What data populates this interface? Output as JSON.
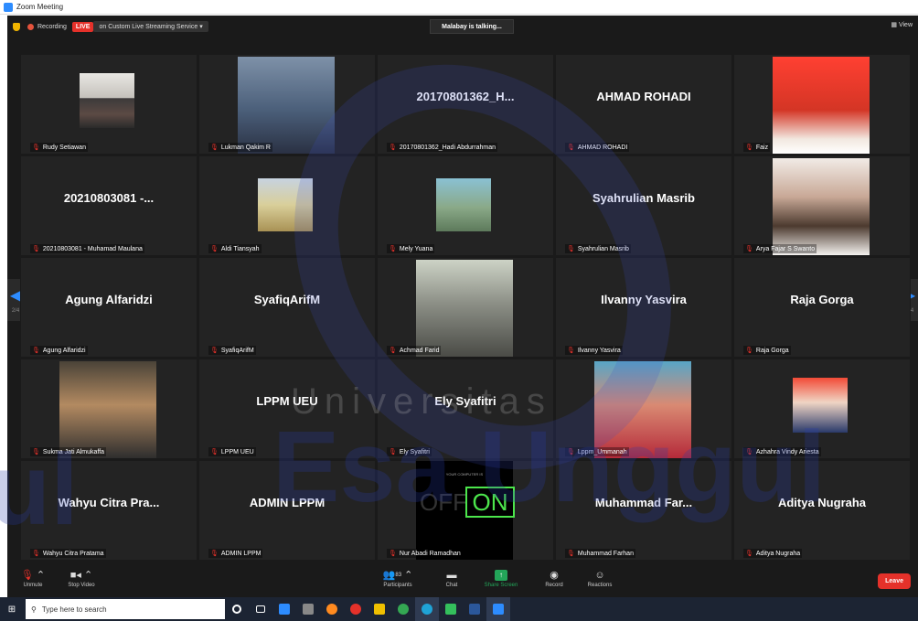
{
  "window": {
    "title": "Zoom Meeting"
  },
  "topbar": {
    "recording": "Recording",
    "live": "LIVE",
    "stream": "on Custom Live Streaming Service",
    "talking": "Malabay is talking...",
    "view": "View"
  },
  "pager": {
    "page": "2/4"
  },
  "tiles": [
    {
      "name": "Rudy Setiawan",
      "big": "",
      "photo": "hat"
    },
    {
      "name": "Lukman Qakim R",
      "big": "",
      "photo": "selfie"
    },
    {
      "name": "20170801362_Hadi Abdurrahman",
      "big": "20170801362_H...",
      "photo": ""
    },
    {
      "name": "AHMAD ROHADI",
      "big": "AHMAD ROHADI",
      "photo": ""
    },
    {
      "name": "Faiz",
      "big": "",
      "photo": "portrait-red"
    },
    {
      "name": "20210803081 - Muhamad Maulana",
      "big": "20210803081 -...",
      "photo": ""
    },
    {
      "name": "Aldi Tiansyah",
      "big": "",
      "photo": "field"
    },
    {
      "name": "Mely Yuana",
      "big": "",
      "photo": "park"
    },
    {
      "name": "Syahrulian Masrib",
      "big": "Syahrulian Masrib",
      "photo": ""
    },
    {
      "name": "Arya Fajar S Swanto",
      "big": "",
      "photo": "girl"
    },
    {
      "name": "Agung Alfaridzi",
      "big": "Agung Alfaridzi",
      "photo": ""
    },
    {
      "name": "SyafiqArifM",
      "big": "SyafiqArifM",
      "photo": ""
    },
    {
      "name": "Achmad Farid",
      "big": "",
      "photo": "street"
    },
    {
      "name": "Ilvanny Yasvira",
      "big": "Ilvanny Yasvira",
      "photo": ""
    },
    {
      "name": "Raja Gorga",
      "big": "Raja Gorga",
      "photo": ""
    },
    {
      "name": "Sukma Jati Almukaffa",
      "big": "",
      "photo": "mask"
    },
    {
      "name": "LPPM UEU",
      "big": "LPPM UEU",
      "photo": ""
    },
    {
      "name": "Ely Syafitri",
      "big": "Ely Syafitri",
      "photo": ""
    },
    {
      "name": "Lppm_Ummanah",
      "big": "",
      "photo": "hijab"
    },
    {
      "name": "Azhahra Vindy Ariesta",
      "big": "",
      "photo": "hijabred"
    },
    {
      "name": "Wahyu Citra Pratama",
      "big": "Wahyu Citra Pra...",
      "photo": ""
    },
    {
      "name": "ADMIN LPPM",
      "big": "ADMIN LPPM",
      "photo": ""
    },
    {
      "name": "Nur Abadi Ramadhan",
      "big": "",
      "photo": "onoff"
    },
    {
      "name": "Muhammad Farhan",
      "big": "Muhammad Far...",
      "photo": ""
    },
    {
      "name": "Aditya Nugraha",
      "big": "Aditya Nugraha",
      "photo": ""
    }
  ],
  "onoff": {
    "caption": "YOUR COMPUTER IS",
    "off": "OFF",
    "on": "ON"
  },
  "toolbar": {
    "unmute": "Unmute",
    "stop_video": "Stop Video",
    "participants": "Participants",
    "participants_count": "83",
    "chat": "Chat",
    "share_screen": "Share Screen",
    "record": "Record",
    "reactions": "Reactions",
    "leave": "Leave"
  },
  "taskbar": {
    "search_placeholder": "Type here to search"
  },
  "watermark": {
    "univ": "Universitas",
    "esa": "Esa Unggul",
    "left": "ul"
  },
  "colors": {
    "accent": "#2d8cff",
    "live": "#e5312a",
    "share": "#23a559",
    "mic_muted": "#e5312a"
  }
}
